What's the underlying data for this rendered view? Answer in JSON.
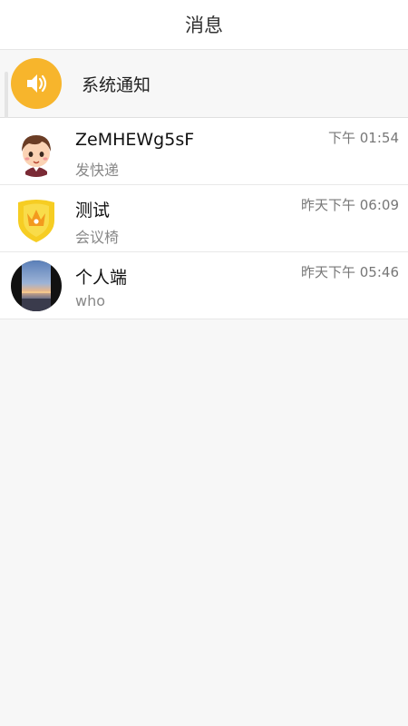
{
  "header": {
    "title": "消息"
  },
  "system_notice": {
    "label": "系统通知",
    "icon": "speaker-icon",
    "color": "#f7b52c"
  },
  "conversations": [
    {
      "name": "ZeMHEWg5sF",
      "message": "发快递",
      "time": "下午 01:54",
      "avatar": "cartoon-boy-avatar"
    },
    {
      "name": "测试",
      "message": "会议椅",
      "time": "昨天下午 06:09",
      "avatar": "yellow-shield-avatar"
    },
    {
      "name": "个人端",
      "message": "who",
      "time": "昨天下午 05:46",
      "avatar": "landscape-photo-avatar"
    }
  ]
}
